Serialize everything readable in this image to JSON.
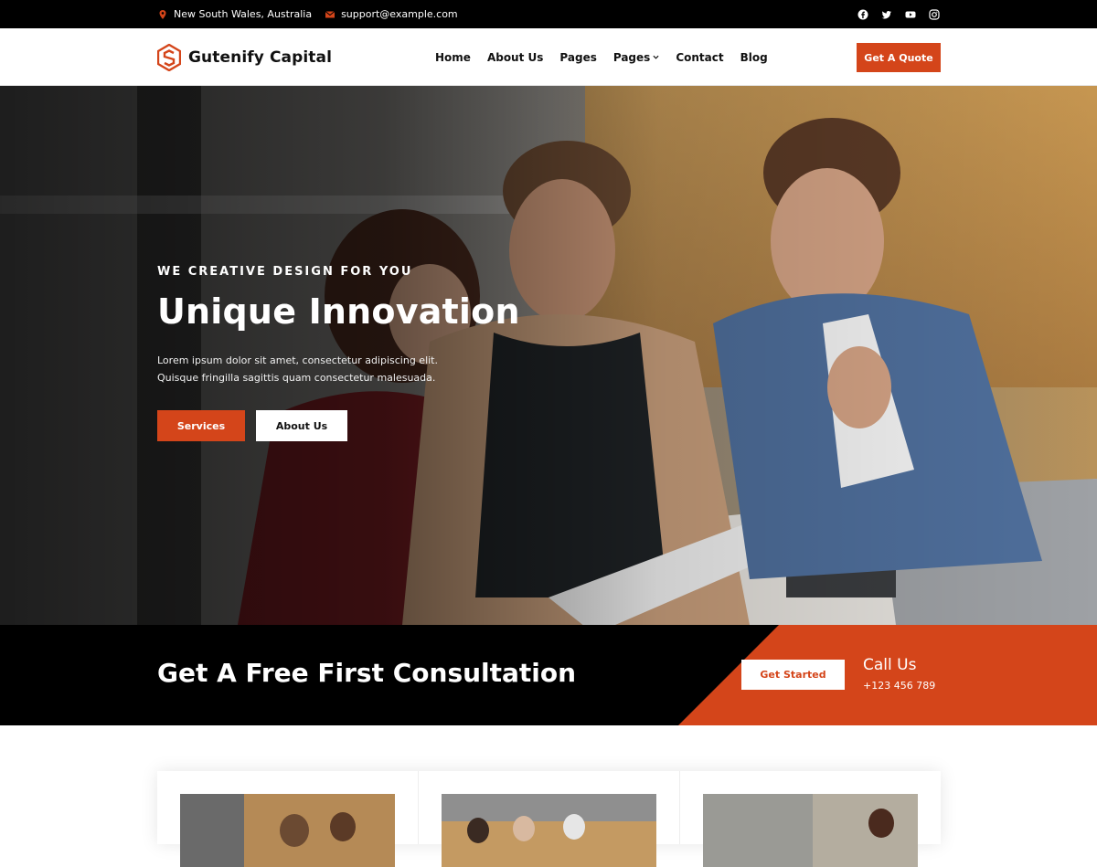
{
  "topbar": {
    "location": "New South Wales, Australia",
    "email": "support@example.com",
    "social": [
      "facebook-icon",
      "twitter-icon",
      "youtube-icon",
      "instagram-icon"
    ]
  },
  "header": {
    "brand": "Gutenify Capital",
    "nav": [
      "Home",
      "About Us",
      "Pages",
      "Pages",
      "Contact",
      "Blog"
    ],
    "cta": "Get A Quote"
  },
  "hero": {
    "eyebrow": "WE CREATIVE DESIGN FOR YOU",
    "title": "Unique Innovation",
    "text_line1": "Lorem ipsum dolor sit amet, consectetur adipiscing elit.",
    "text_line2": "Quisque fringilla sagittis quam consectetur malesuada.",
    "btn_primary": "Services",
    "btn_secondary": "About Us"
  },
  "consultation": {
    "title": "Get A Free First Consultation",
    "button": "Get Started",
    "call_label": "Call Us",
    "phone": "+123 456 789"
  },
  "colors": {
    "accent": "#d4451a",
    "dark": "#000000"
  }
}
